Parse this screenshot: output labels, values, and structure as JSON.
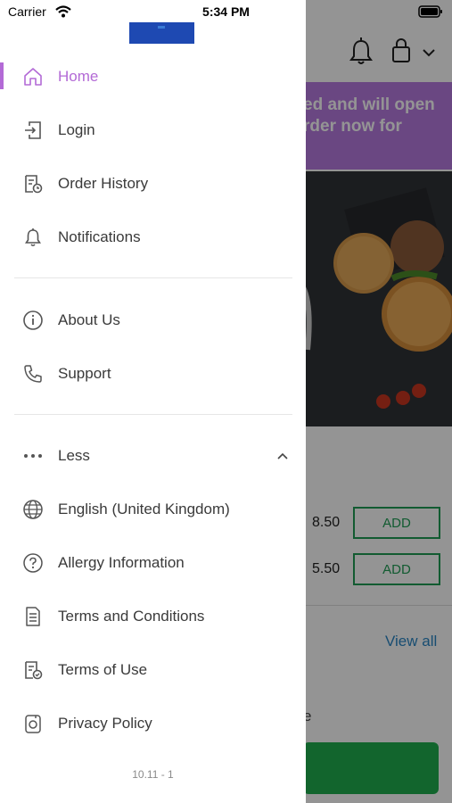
{
  "status_bar": {
    "carrier": "Carrier",
    "time": "5:34 PM"
  },
  "background": {
    "banner_text": "ed and will open\nrder now for",
    "prices": [
      "8.50",
      "5.50"
    ],
    "add_label": "ADD",
    "view_all": "View all",
    "partial_text": "e"
  },
  "menu": {
    "primary": [
      {
        "label": "Home",
        "icon": "home-icon",
        "active": true
      },
      {
        "label": "Login",
        "icon": "login-icon"
      },
      {
        "label": "Order History",
        "icon": "order-history-icon"
      },
      {
        "label": "Notifications",
        "icon": "bell-icon"
      }
    ],
    "secondary": [
      {
        "label": "About Us",
        "icon": "info-icon"
      },
      {
        "label": "Support",
        "icon": "phone-icon"
      }
    ],
    "less_toggle": {
      "label": "Less",
      "icon": "more-dots-icon"
    },
    "more": [
      {
        "label": "English (United Kingdom)",
        "icon": "globe-icon"
      },
      {
        "label": "Allergy Information",
        "icon": "question-icon"
      },
      {
        "label": "Terms and Conditions",
        "icon": "document-icon"
      },
      {
        "label": "Terms of Use",
        "icon": "document-check-icon"
      },
      {
        "label": "Privacy Policy",
        "icon": "privacy-icon"
      }
    ]
  },
  "version": "10.11 - 1",
  "colors": {
    "accent": "#b36ad6",
    "text": "#3a3a3a",
    "banner": "#b77be0",
    "add_green": "#1f9d55",
    "link_blue": "#2a86c4"
  }
}
